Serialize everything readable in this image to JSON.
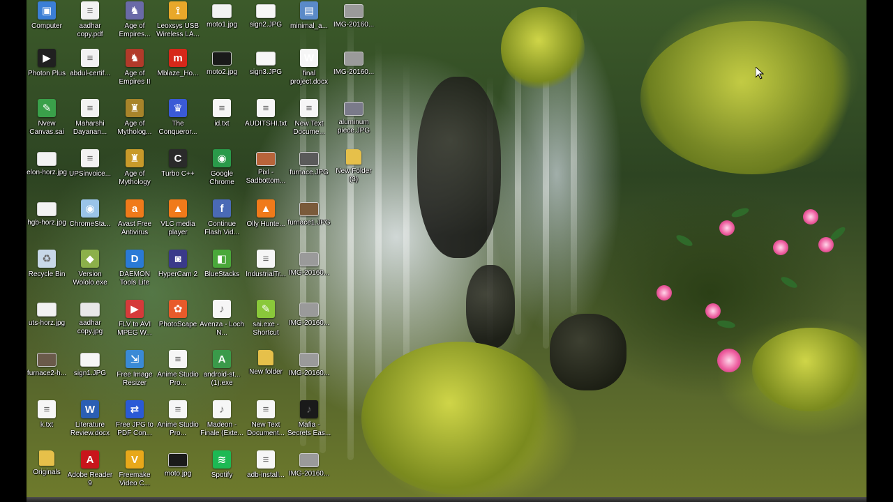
{
  "desktop": {
    "columns": [
      [
        {
          "label": "Computer",
          "icon": "computer-icon",
          "color": "#3b7fd6"
        },
        {
          "label": "Photon Plus",
          "icon": "photon-plus-icon",
          "color": "#202020"
        },
        {
          "label": "Nvew Canvas.sai",
          "icon": "sai-file-icon",
          "color": "#3aa04a"
        },
        {
          "label": "elon-horz.jpg",
          "icon": "image-file-icon",
          "color": "#f2f2f2"
        },
        {
          "label": "hgb-horz.jpg",
          "icon": "image-file-icon",
          "color": "#f2f2f2"
        },
        {
          "label": "Recycle Bin",
          "icon": "recycle-bin-icon",
          "color": "#c8d8e8"
        },
        {
          "label": "uts-horz.jpg",
          "icon": "image-file-icon",
          "color": "#f2f2f2"
        },
        {
          "label": "furnace2-h...",
          "icon": "image-file-icon",
          "color": "#6a5a4a"
        },
        {
          "label": "k.txt",
          "icon": "text-file-icon",
          "color": "#f6f6f6"
        },
        {
          "label": "Originals",
          "icon": "folder-icon",
          "color": "#e6c04a"
        }
      ],
      [
        {
          "label": "aadhar copy.pdf",
          "icon": "pdf-file-icon",
          "color": "#f2f2f2"
        },
        {
          "label": "abdul-certif...",
          "icon": "document-file-icon",
          "color": "#f2f2f2"
        },
        {
          "label": "Maharshi Dayanan...",
          "icon": "document-file-icon",
          "color": "#f2f2f2"
        },
        {
          "label": "UPSinvoice...",
          "icon": "document-file-icon",
          "color": "#f2f2f2"
        },
        {
          "label": "ChromeSta...",
          "icon": "chrome-setup-icon",
          "color": "#9ac4e8"
        },
        {
          "label": "Version Wololo.exe",
          "icon": "app-icon",
          "color": "#8cb04a"
        },
        {
          "label": "aadhar copy.jpg",
          "icon": "image-file-icon",
          "color": "#e8e8e8"
        },
        {
          "label": "sign1.JPG",
          "icon": "image-file-icon",
          "color": "#f6f6f6"
        },
        {
          "label": "Literature Review.docx",
          "icon": "word-document-icon",
          "color": "#2b5fb3"
        },
        {
          "label": "Adobe Reader 9",
          "icon": "adobe-reader-icon",
          "color": "#c8151b"
        }
      ],
      [
        {
          "label": "Age of Empires...",
          "icon": "age-of-empires-icon",
          "color": "#6a6aa8"
        },
        {
          "label": "Age of Empires II",
          "icon": "age-of-empires-icon",
          "color": "#b23a2a"
        },
        {
          "label": "Age of Mytholog...",
          "icon": "age-of-mythology-icon",
          "color": "#a8842a"
        },
        {
          "label": "Age of Mythology",
          "icon": "age-of-mythology-icon",
          "color": "#c89a2a"
        },
        {
          "label": "Avast Free Antivirus",
          "icon": "avast-icon",
          "color": "#f07a1a"
        },
        {
          "label": "DAEMON Tools Lite",
          "icon": "daemon-tools-icon",
          "color": "#2a7ad6"
        },
        {
          "label": "FLV to AVI MPEG W...",
          "icon": "flv-converter-icon",
          "color": "#d63a3a"
        },
        {
          "label": "Free Image Resizer",
          "icon": "image-resizer-icon",
          "color": "#3a8ad6"
        },
        {
          "label": "Free JPG to PDF Con...",
          "icon": "jpg-to-pdf-icon",
          "color": "#2a5ad6"
        },
        {
          "label": "Freemake Video C...",
          "icon": "freemake-icon",
          "color": "#e8a81a"
        }
      ],
      [
        {
          "label": "Leoxsys USB Wireless LA...",
          "icon": "wireless-icon",
          "color": "#e8a82a"
        },
        {
          "label": "Mblaze_Ho...",
          "icon": "mblaze-icon",
          "color": "#d6281a"
        },
        {
          "label": "The Conqueror...",
          "icon": "game-icon",
          "color": "#3a5ad6"
        },
        {
          "label": "Turbo C++",
          "icon": "turbo-c-icon",
          "color": "#2a2a2a"
        },
        {
          "label": "VLC media player",
          "icon": "vlc-icon",
          "color": "#f07a1a"
        },
        {
          "label": "HyperCam 2",
          "icon": "hypercam-icon",
          "color": "#3a3a8a"
        },
        {
          "label": "PhotoScape",
          "icon": "photoscape-icon",
          "color": "#e85a2a"
        },
        {
          "label": "Anime Studio Pro...",
          "icon": "text-file-icon",
          "color": "#f6f6f6"
        },
        {
          "label": "Anime Studio Pro...",
          "icon": "text-file-icon",
          "color": "#f6f6f6"
        },
        {
          "label": "moto.jpg",
          "icon": "image-file-icon",
          "color": "#1a1a1a"
        }
      ],
      [
        {
          "label": "moto1.jpg",
          "icon": "image-file-icon",
          "color": "#f2f2f2"
        },
        {
          "label": "moto2.jpg",
          "icon": "image-file-icon",
          "color": "#1a1a1a"
        },
        {
          "label": "id.txt",
          "icon": "text-file-icon",
          "color": "#f6f6f6"
        },
        {
          "label": "Google Chrome",
          "icon": "chrome-icon",
          "color": "#2a9a4a"
        },
        {
          "label": "Continue Flash Vid...",
          "icon": "flash-video-icon",
          "color": "#4a6ab6"
        },
        {
          "label": "BlueStacks",
          "icon": "bluestacks-icon",
          "color": "#4aa83a"
        },
        {
          "label": "Avenza - Loch N...",
          "icon": "audio-file-icon",
          "color": "#f6f6f6"
        },
        {
          "label": "android-st... (1).exe",
          "icon": "android-studio-icon",
          "color": "#3a9a4a"
        },
        {
          "label": "Madeon - Finale (Exte...",
          "icon": "audio-file-icon",
          "color": "#f6f6f6"
        },
        {
          "label": "Spotify",
          "icon": "spotify-icon",
          "color": "#1db954"
        }
      ],
      [
        {
          "label": "sign2.JPG",
          "icon": "image-file-icon",
          "color": "#f6f6f6"
        },
        {
          "label": "sign3.JPG",
          "icon": "image-file-icon",
          "color": "#f6f6f6"
        },
        {
          "label": "AUDITSHI.txt",
          "icon": "text-file-icon",
          "color": "#f6f6f6"
        },
        {
          "label": "Pixl - Sadbottom...",
          "icon": "image-file-icon",
          "color": "#b8643a"
        },
        {
          "label": "Olly Hunte...",
          "icon": "vlc-icon",
          "color": "#f07a1a"
        },
        {
          "label": "IndustrialTr...",
          "icon": "document-file-icon",
          "color": "#f6f6f6"
        },
        {
          "label": "sai.exe - Shortcut",
          "icon": "sai-shortcut-icon",
          "color": "#8ac83a"
        },
        {
          "label": "New folder",
          "icon": "folder-icon",
          "color": "#e6c04a"
        },
        {
          "label": "New Text Document...",
          "icon": "text-file-icon",
          "color": "#f6f6f6"
        },
        {
          "label": "adb-install...",
          "icon": "text-file-icon",
          "color": "#f6f6f6"
        }
      ],
      [
        {
          "label": "minimal_a...",
          "icon": "minimal-adb-icon",
          "color": "#5a8ac8"
        },
        {
          "label": "final project.docx",
          "icon": "word-document-icon",
          "color": "#f6f6f6"
        },
        {
          "label": "New Text Docume...",
          "icon": "text-file-icon",
          "color": "#f6f6f6"
        },
        {
          "label": "furnace.JPG",
          "icon": "image-file-icon",
          "color": "#5a5a5a"
        },
        {
          "label": "furnace1.JPG",
          "icon": "image-file-icon",
          "color": "#7a5a3a"
        },
        {
          "label": "IMG-20160...",
          "icon": "image-file-icon",
          "color": "#9a9a9a"
        },
        {
          "label": "IMG-20160...",
          "icon": "image-file-icon",
          "color": "#9a9a9a"
        },
        {
          "label": "IMG-20160...",
          "icon": "image-file-icon",
          "color": "#9a9a9a"
        },
        {
          "label": "Mafia - Secrets Eas...",
          "icon": "audio-file-icon",
          "color": "#1a1a1a"
        },
        {
          "label": "IMG-20160...",
          "icon": "image-file-icon",
          "color": "#9a9a9a"
        }
      ],
      [
        {
          "label": "IMG-20160...",
          "icon": "image-file-icon",
          "color": "#9a9a9a"
        },
        {
          "label": "IMG-20160...",
          "icon": "image-file-icon",
          "color": "#9a9a9a"
        },
        {
          "label": "aluminum piece.JPG",
          "icon": "image-file-icon",
          "color": "#7a7a8a"
        },
        {
          "label": "New Folder (3)",
          "icon": "folder-icon",
          "color": "#e6c04a"
        }
      ]
    ]
  },
  "cursor": {
    "icon": "mouse-pointer-icon"
  }
}
